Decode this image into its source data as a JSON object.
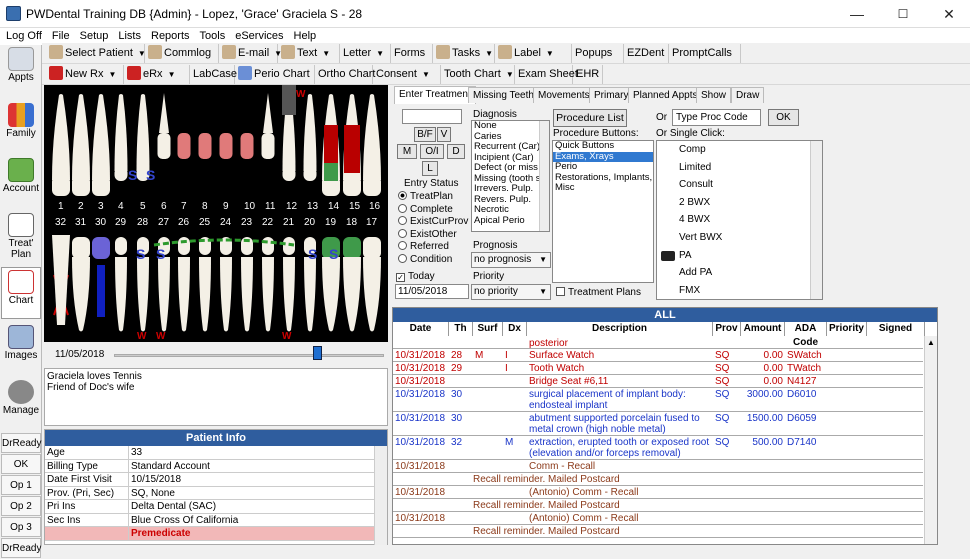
{
  "window": {
    "title": "PWDental Training DB {Admin} - Lopez, 'Grace' Graciela S - 28",
    "min": "—",
    "max": "☐",
    "close": "✕"
  },
  "menu": [
    "Log Off",
    "File",
    "Setup",
    "Lists",
    "Reports",
    "Tools",
    "eServices",
    "Help"
  ],
  "toolbar1": [
    {
      "label": "Select Patient",
      "icon": "patient-icon",
      "dd": true
    },
    {
      "label": "Commlog",
      "icon": "commlog-icon",
      "dd": false
    },
    {
      "label": "E-mail",
      "icon": "email-icon",
      "dd": true
    },
    {
      "label": "Text",
      "icon": "text-icon",
      "dd": true
    },
    {
      "label": "Letter",
      "icon": "",
      "dd": true
    },
    {
      "label": "Forms",
      "icon": "",
      "dd": false
    },
    {
      "label": "Tasks",
      "icon": "tasks-icon",
      "dd": true
    },
    {
      "label": "Label",
      "icon": "label-icon",
      "dd": true
    },
    {
      "label": "Popups",
      "icon": "",
      "dd": false
    },
    {
      "label": "EZDent",
      "icon": "",
      "dd": false
    },
    {
      "label": "PromptCalls",
      "icon": "",
      "dd": false
    }
  ],
  "toolbar2": [
    {
      "label": "New Rx",
      "icon": "rx-icon",
      "dd": true
    },
    {
      "label": "eRx",
      "icon": "rx-icon",
      "dd": true
    },
    {
      "label": "LabCase",
      "icon": "",
      "dd": false
    },
    {
      "label": "Perio Chart",
      "icon": "perio-icon",
      "dd": false
    },
    {
      "label": "Ortho Chart",
      "icon": "",
      "dd": false
    },
    {
      "label": "Consent",
      "icon": "",
      "dd": true
    },
    {
      "label": "Tooth Chart",
      "icon": "",
      "dd": true
    },
    {
      "label": "Exam Sheet",
      "icon": "",
      "dd": false
    },
    {
      "label": "EHR",
      "icon": "",
      "dd": false
    }
  ],
  "sidebar": {
    "items": [
      "Appts",
      "Family",
      "Account",
      "Treat' Plan",
      "Chart",
      "Images",
      "Manage"
    ],
    "small": [
      "DrReady",
      "OK",
      "Op 1",
      "Op 2",
      "Op 3",
      "DrReady"
    ]
  },
  "chart": {
    "upper_numbers": [
      "1",
      "2",
      "3",
      "4",
      "5",
      "6",
      "7",
      "8",
      "9",
      "10",
      "11",
      "12",
      "13",
      "14",
      "15",
      "16"
    ],
    "lower_numbers": [
      "32",
      "31",
      "30",
      "29",
      "28",
      "27",
      "26",
      "25",
      "24",
      "23",
      "22",
      "21",
      "20",
      "19",
      "18",
      "17"
    ],
    "marks": {
      "s": "S",
      "w": "W"
    },
    "colors": {
      "tooth": "#f4f0e6",
      "restoration": "#e07a7a",
      "sealant": "#3344cc",
      "green": "#3f9a4a",
      "missing_x": "#cc0000"
    }
  },
  "date": "11/05/2018",
  "slider_level": 0.75,
  "notes": [
    "Graciela loves Tennis",
    "Friend of Doc's wife"
  ],
  "patient_info": {
    "header": "Patient Info",
    "rows": [
      [
        "Age",
        "33"
      ],
      [
        "Billing Type",
        "Standard Account"
      ],
      [
        "Date First Visit",
        "10/15/2018"
      ],
      [
        "Prov. (Pri, Sec)",
        "SQ, None"
      ],
      [
        "Pri Ins",
        "Delta Dental (SAC)"
      ],
      [
        "Sec Ins",
        "Blue Cross Of California"
      ],
      [
        "",
        "Premedicate"
      ]
    ]
  },
  "treat": {
    "tabs": [
      "Enter Treatment",
      "Missing Teeth",
      "Movements",
      "Primary",
      "Planned Appts",
      "Show",
      "Draw"
    ],
    "surface_buttons": [
      "B/F",
      "V",
      "M",
      "O/I",
      "D",
      "L"
    ],
    "entry_status_label": "Entry Status",
    "entry_status": [
      "TreatPlan",
      "Complete",
      "ExistCurProv",
      "ExistOther",
      "Referred",
      "Condition"
    ],
    "today_label": "Today",
    "today_date": "11/05/2018",
    "diagnosis_label": "Diagnosis",
    "diagnosis": [
      "None",
      "Caries",
      "Recurrent (Car)",
      "Incipient (Car)",
      "Defect (or miss",
      "Missing (tooth s",
      "Irrevers. Pulp.",
      "Revers. Pulp.",
      "Necrotic",
      "Apical Perio"
    ],
    "prognosis_label": "Prognosis",
    "prognosis": "no prognosis",
    "priority_label": "Priority",
    "priority": "no priority",
    "proc_list_btn": "Procedure List",
    "proc_buttons_label": "Procedure Buttons:",
    "proc_buttons": [
      "Quick Buttons",
      "Exams, Xrays",
      "Perio",
      "Restorations, Implants, Su",
      "Misc"
    ],
    "treatment_plans_label": "Treatment Plans",
    "or_label": "Or",
    "code_placeholder": "Type Proc Code",
    "ok": "OK",
    "single_click_label": "Or Single Click:",
    "single_click": [
      "Comp",
      "Limited",
      "Consult",
      "2 BWX",
      "4 BWX",
      "Vert BWX",
      "PA",
      "Add PA",
      "FMX"
    ]
  },
  "proclog": {
    "title": "ALL",
    "columns": [
      "Date",
      "Th",
      "Surf",
      "Dx",
      "Description",
      "Prov",
      "Amount",
      "ADA Code",
      "Priority",
      "Signed"
    ],
    "rows": [
      {
        "date": "",
        "th": "",
        "surf": "",
        "dx": "",
        "desc": "posterior",
        "prov": "",
        "amount": "",
        "code": "",
        "color": "red",
        "h": 12
      },
      {
        "date": "10/31/2018",
        "th": "28",
        "surf": "M",
        "dx": "I",
        "desc": "Surface Watch",
        "prov": "SQ",
        "amount": "0.00",
        "code": "SWatch",
        "color": "red",
        "h": 13
      },
      {
        "date": "10/31/2018",
        "th": "29",
        "surf": "",
        "dx": "I",
        "desc": "Tooth Watch",
        "prov": "SQ",
        "amount": "0.00",
        "code": "TWatch",
        "color": "red",
        "h": 13
      },
      {
        "date": "10/31/2018",
        "th": "",
        "surf": "",
        "dx": "",
        "desc": "Bridge Seat #6,11",
        "prov": "SQ",
        "amount": "0.00",
        "code": "N4127",
        "color": "red",
        "h": 13
      },
      {
        "date": "10/31/2018",
        "th": "30",
        "surf": "",
        "dx": "",
        "desc": "surgical placement of implant body: endosteal implant",
        "prov": "SQ",
        "amount": "3000.00",
        "code": "D6010",
        "color": "blue",
        "h": 24
      },
      {
        "date": "10/31/2018",
        "th": "30",
        "surf": "",
        "dx": "",
        "desc": "abutment supported porcelain fused to metal crown (high noble metal)",
        "prov": "SQ",
        "amount": "1500.00",
        "code": "D6059",
        "color": "blue",
        "h": 24
      },
      {
        "date": "10/31/2018",
        "th": "32",
        "surf": "",
        "dx": "M",
        "desc": "extraction, erupted tooth or exposed root (elevation and/or forceps removal)",
        "prov": "SQ",
        "amount": "500.00",
        "code": "D7140",
        "color": "blue",
        "h": 24
      },
      {
        "date": "10/31/2018",
        "th": "",
        "surf": "",
        "dx": "",
        "desc": "Comm - Recall",
        "prov": "",
        "amount": "",
        "code": "",
        "color": "brown",
        "h": 13
      },
      {
        "date": "",
        "th": "",
        "surf": "",
        "dx": "",
        "desc": "Recall reminder.  Mailed Postcard",
        "prov": "",
        "amount": "",
        "code": "",
        "color": "brown",
        "h": 13,
        "indent": true
      },
      {
        "date": "10/31/2018",
        "th": "",
        "surf": "",
        "dx": "",
        "desc": "(Antonio) Comm - Recall",
        "prov": "",
        "amount": "",
        "code": "",
        "color": "brown",
        "h": 13
      },
      {
        "date": "",
        "th": "",
        "surf": "",
        "dx": "",
        "desc": "Recall reminder.  Mailed Postcard",
        "prov": "",
        "amount": "",
        "code": "",
        "color": "brown",
        "h": 13,
        "indent": true
      },
      {
        "date": "10/31/2018",
        "th": "",
        "surf": "",
        "dx": "",
        "desc": "(Antonio) Comm - Recall",
        "prov": "",
        "amount": "",
        "code": "",
        "color": "brown",
        "h": 13
      },
      {
        "date": "",
        "th": "",
        "surf": "",
        "dx": "",
        "desc": "Recall reminder.  Mailed Postcard",
        "prov": "",
        "amount": "",
        "code": "",
        "color": "brown",
        "h": 13,
        "indent": true
      }
    ]
  }
}
